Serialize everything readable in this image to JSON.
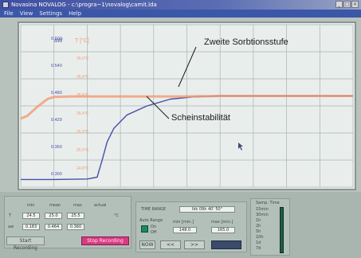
{
  "window": {
    "title": "Novasina NOVALOG - c:\\progra~1\\novalog\\camit.lda",
    "controls": [
      "_",
      "□",
      "×"
    ]
  },
  "menu": [
    "File",
    "View",
    "Settings",
    "Help"
  ],
  "chart_data": {
    "type": "line",
    "title": "",
    "y_left_label": "aW",
    "y_right_label": "T [°C]",
    "y_left_ticks": [
      "0.600",
      "0.540",
      "0.480",
      "0.420",
      "0.360",
      "0.300"
    ],
    "y_right_ticks": [
      "26.0°C",
      "25.8°C",
      "25.6°C",
      "25.4°C",
      "25.2°C",
      "25.0°C",
      "24.8°C"
    ],
    "ylim": [
      0.27,
      0.63
    ],
    "xlim": [
      0,
      10
    ],
    "grid": true,
    "series": [
      {
        "color": "#4a4fa8",
        "x": [
          0.0,
          1.0,
          2.0,
          2.3,
          2.45,
          2.6,
          2.8,
          3.2,
          3.8,
          4.5,
          5.2,
          6.0,
          7.0,
          8.0,
          9.0,
          10.0
        ],
        "y": [
          0.287,
          0.287,
          0.288,
          0.292,
          0.33,
          0.37,
          0.4,
          0.43,
          0.45,
          0.465,
          0.47,
          0.472,
          0.472,
          0.472,
          0.472,
          0.472
        ]
      },
      {
        "color": "#f29a72",
        "x": [
          0.0,
          0.2,
          0.5,
          0.8,
          1.0,
          1.5,
          2.0,
          3.0,
          4.0,
          5.0,
          6.0,
          7.0,
          8.0,
          9.0,
          10.0
        ],
        "y": [
          0.422,
          0.428,
          0.448,
          0.465,
          0.47,
          0.471,
          0.471,
          0.471,
          0.471,
          0.471,
          0.472,
          0.472,
          0.472,
          0.472,
          0.472
        ]
      }
    ],
    "annotations": [
      {
        "text": "Zweite Sorbtionsstufe"
      },
      {
        "text": "Scheinstabilität"
      }
    ]
  },
  "panel": {
    "stats_headers": [
      "min",
      "mean",
      "max",
      "actual"
    ],
    "row1_label": "T",
    "row1_values": [
      "24.5",
      "25.0",
      "25.5"
    ],
    "row1_unit": "°C",
    "row2_label": "aw",
    "row2_values": [
      "0.183",
      "0.464",
      "0.360"
    ],
    "btn_start": "Start Recording",
    "btn_stop": "Stop Recording",
    "time_label": "TIME RANGE",
    "time_value": "Ikk 09h 40' 50\"",
    "auto_range_label": "Auto Range",
    "auto_on": "On",
    "auto_off": "Off",
    "min_label": "min [min.]",
    "max_label": "max [min.]",
    "min_value": "148.0",
    "max_value": "165.0",
    "nav_now": "NOW",
    "nav_back": "<<",
    "nav_fwd": ">>",
    "samp_label": "Samp. Time",
    "samp_options": [
      "15min",
      "30min",
      "1h",
      "2h",
      "5h",
      "10h",
      "1d",
      "7d"
    ]
  }
}
